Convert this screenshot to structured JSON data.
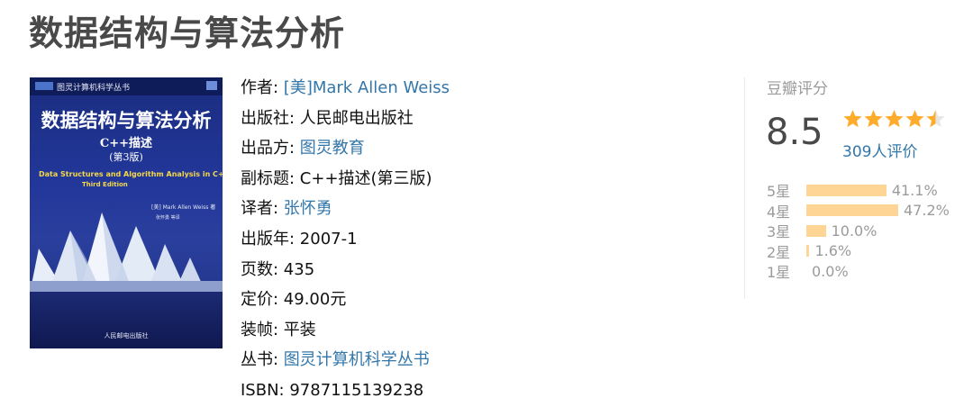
{
  "book": {
    "title": "数据结构与算法分析"
  },
  "cover": {
    "series": "图灵计算机科学丛书",
    "title": "数据结构与算法分析",
    "subtitle": "C++描述",
    "edition": "(第3版)",
    "english_title": "Data Structures and Algorithm Analysis in C++",
    "english_edition": "Third Edition",
    "author": "[美] Mark Allen Weiss 著",
    "translators": "张怀勇 等译",
    "publisher": "人民邮电出版社"
  },
  "info": {
    "author_label": "作者: ",
    "author": "[美]Mark Allen Weiss",
    "publisher_label": "出版社: ",
    "publisher": "人民邮电出版社",
    "producer_label": "出品方: ",
    "producer": "图灵教育",
    "subtitle_label": "副标题: ",
    "subtitle": "C++描述(第三版)",
    "translator_label": "译者: ",
    "translator": "张怀勇",
    "year_label": "出版年: ",
    "year": "2007-1",
    "pages_label": "页数: ",
    "pages": "435",
    "price_label": "定价: ",
    "price": "49.00元",
    "binding_label": "装帧: ",
    "binding": "平装",
    "series_label": "丛书: ",
    "series": "图灵计算机科学丛书",
    "isbn_label": "ISBN: ",
    "isbn": "9787115139238"
  },
  "rating": {
    "label": "豆瓣评分",
    "score": "8.5",
    "stars_value": 4.5,
    "count": "309人评价",
    "star_color": "#ffac2d",
    "bar_color": "#ffd596",
    "distribution": [
      {
        "label": "5星",
        "percent": 41.1,
        "text": "41.1%"
      },
      {
        "label": "4星",
        "percent": 47.2,
        "text": "47.2%"
      },
      {
        "label": "3星",
        "percent": 10.0,
        "text": "10.0%"
      },
      {
        "label": "2星",
        "percent": 1.6,
        "text": "1.6%"
      },
      {
        "label": "1星",
        "percent": 0.0,
        "text": "0.0%"
      }
    ]
  }
}
